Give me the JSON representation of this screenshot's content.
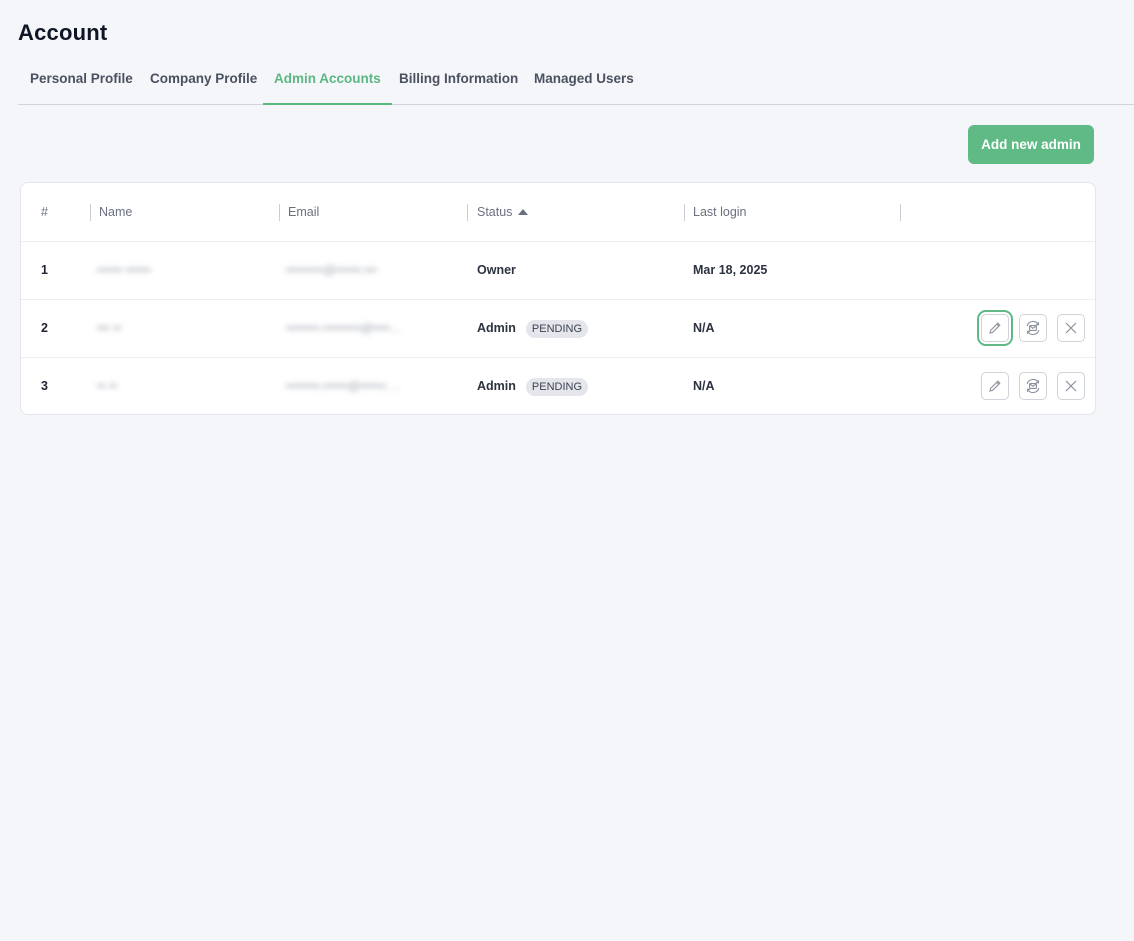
{
  "page": {
    "title": "Account"
  },
  "tabs": [
    {
      "label": "Personal Profile",
      "active": false
    },
    {
      "label": "Company Profile",
      "active": false
    },
    {
      "label": "Admin Accounts",
      "active": true
    },
    {
      "label": "Billing Information",
      "active": false
    },
    {
      "label": "Managed Users",
      "active": false
    }
  ],
  "actions": {
    "add_admin_label": "Add new admin"
  },
  "table": {
    "headers": {
      "index": "#",
      "name": "Name",
      "email": "Email",
      "status": "Status",
      "last_login": "Last login"
    },
    "sort": {
      "column": "Status",
      "direction": "ascending"
    },
    "rows": [
      {
        "index": "1",
        "name": "•••••• ••••••",
        "email": "•••••••••@••••••.•••",
        "status": "Owner",
        "badge": "",
        "last_login": "Mar 18, 2025"
      },
      {
        "index": "2",
        "name": "••• ••",
        "email": "••••••••.•••••••••@••••...",
        "status": "Admin",
        "badge": "PENDING",
        "last_login": "N/A"
      },
      {
        "index": "3",
        "name": "•• ••",
        "email": "••••••••.••••••@••••••, ..",
        "status": "Admin",
        "badge": "PENDING",
        "last_login": "N/A"
      }
    ]
  },
  "icons": {
    "edit": "pencil-icon",
    "resend": "resend-invite-icon",
    "remove": "close-icon"
  },
  "colors": {
    "accent": "#5fba85",
    "background": "#f5f6fa",
    "badge_bg": "#e4e6eb"
  }
}
